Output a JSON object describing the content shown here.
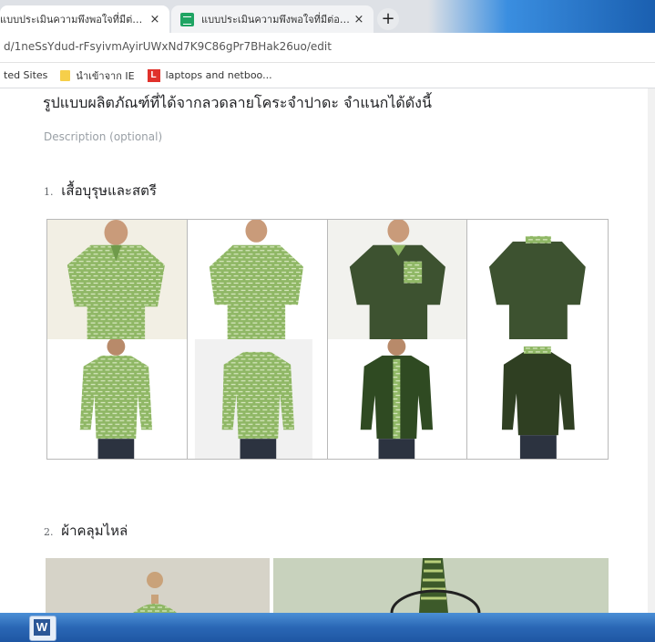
{
  "tabs": [
    {
      "label": "แบบประเมินความพึงพอใจที่มีต่อรูปแ",
      "active": true
    },
    {
      "label": "แบบประเมินความพึงพอใจที่มีต่อรูปแ",
      "active": false
    }
  ],
  "icons": {
    "tab_close": "×",
    "new_tab": "+",
    "sheets": "sheets-icon"
  },
  "address": {
    "url": "d/1neSsYdud-rFsyivmAyirUWxNd7K9C86gPr7BHak26uo/edit"
  },
  "bookmarks": [
    {
      "label": "ted Sites",
      "icon": ""
    },
    {
      "label": "นำเข้าจาก IE",
      "icon": "folder-icon"
    },
    {
      "label": "laptops and netboo...",
      "icon": "l-icon"
    }
  ],
  "form": {
    "heading": "รูปแบบผลิตภัณฑ์ที่ได้จากลวดลายโคระจำปาดะ จำแนกได้ดังนี้",
    "description": "Description (optional)",
    "sections": [
      {
        "number": "1.",
        "title": "เสื้อบุรุษและสตรี"
      },
      {
        "number": "2.",
        "title": "ผ้าคลุมไหล่"
      }
    ]
  },
  "colors": {
    "pattern_green": "#8fb765",
    "dark_green": "#3d5230",
    "darker_green": "#2f3f22",
    "taskbar": "#2a67b5"
  },
  "taskbar": {
    "word_label": "W"
  }
}
